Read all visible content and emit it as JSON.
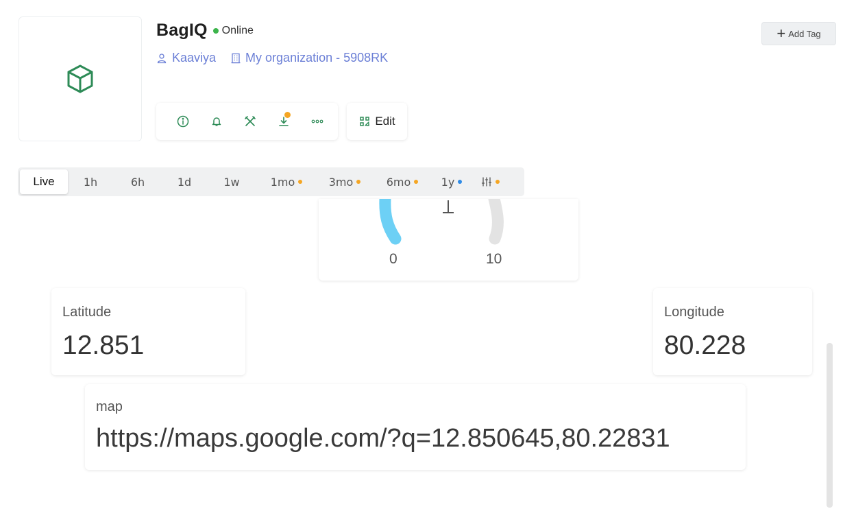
{
  "device": {
    "name": "BagIQ",
    "status": "Online",
    "owner": "Kaaviya",
    "organization": "My organization - 5908RK",
    "icon": "cube-icon"
  },
  "header": {
    "add_tag_label": "Add Tag",
    "edit_label": "Edit"
  },
  "actions": [
    {
      "name": "info-icon"
    },
    {
      "name": "bell-icon"
    },
    {
      "name": "tools-icon"
    },
    {
      "name": "download-icon",
      "badge": true
    },
    {
      "name": "more-icon"
    }
  ],
  "time_ranges": [
    {
      "label": "Live",
      "active": true
    },
    {
      "label": "1h"
    },
    {
      "label": "6h"
    },
    {
      "label": "1d"
    },
    {
      "label": "1w"
    },
    {
      "label": "1mo",
      "dot": "#f5a623"
    },
    {
      "label": "3mo",
      "dot": "#f5a623"
    },
    {
      "label": "6mo",
      "dot": "#f5a623"
    },
    {
      "label": "1y",
      "dot": "#2f8be6"
    },
    {
      "label": "",
      "icon": "sliders-icon",
      "dot": "#f5a623"
    }
  ],
  "gauge": {
    "min_label": "0",
    "max_label": "10",
    "value": 0,
    "fill_color": "#6dd0f5",
    "track_color": "#e3e3e3"
  },
  "latitude": {
    "label": "Latitude",
    "value": "12.851"
  },
  "longitude": {
    "label": "Longitude",
    "value": "80.228"
  },
  "map": {
    "label": "map",
    "value": "https://maps.google.com/?q=12.850645,80.22831"
  },
  "colors": {
    "accent_green": "#2e8b57",
    "link_blue": "#6b7fd6",
    "online_green": "#3cb44b",
    "badge_orange": "#f5a623"
  }
}
